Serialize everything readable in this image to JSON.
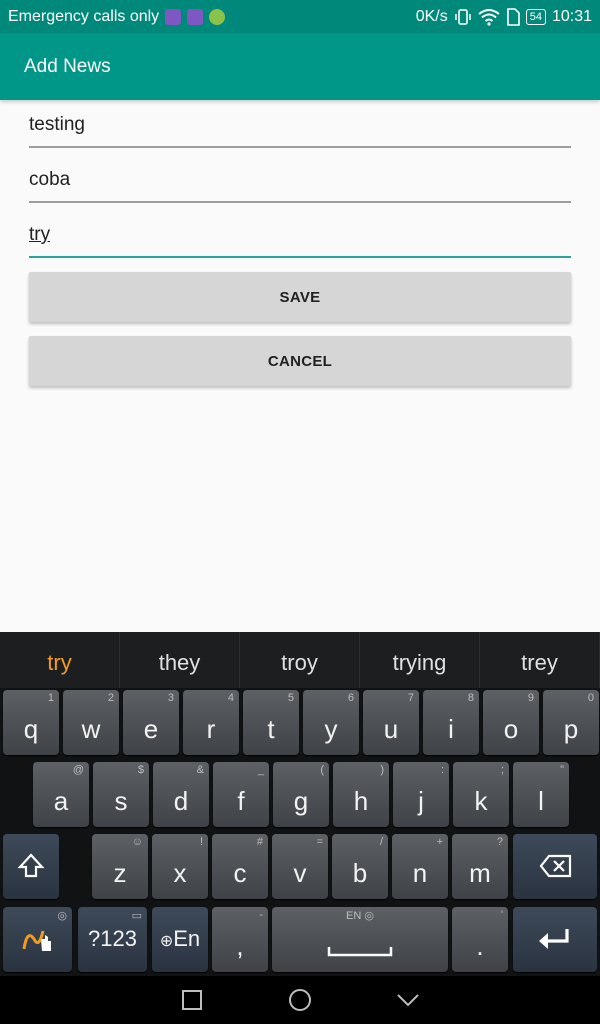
{
  "status_bar": {
    "carrier_text": "Emergency calls only",
    "net_speed": "0K/s",
    "battery": "54",
    "time": "10:31"
  },
  "app_bar": {
    "title": "Add News"
  },
  "form": {
    "field1_value": "testing",
    "field2_value": "coba",
    "field3_value": "try",
    "save_label": "SAVE",
    "cancel_label": "CANCEL"
  },
  "keyboard": {
    "suggestions": [
      "try",
      "they",
      "troy",
      "trying",
      "trey"
    ],
    "row1": [
      {
        "k": "q",
        "h": "1"
      },
      {
        "k": "w",
        "h": "2"
      },
      {
        "k": "e",
        "h": "3"
      },
      {
        "k": "r",
        "h": "4"
      },
      {
        "k": "t",
        "h": "5"
      },
      {
        "k": "y",
        "h": "6"
      },
      {
        "k": "u",
        "h": "7"
      },
      {
        "k": "i",
        "h": "8"
      },
      {
        "k": "o",
        "h": "9"
      },
      {
        "k": "p",
        "h": "0"
      }
    ],
    "row2": [
      {
        "k": "a",
        "h": "@"
      },
      {
        "k": "s",
        "h": "$"
      },
      {
        "k": "d",
        "h": "&"
      },
      {
        "k": "f",
        "h": "_"
      },
      {
        "k": "g",
        "h": "("
      },
      {
        "k": "h",
        "h": ")"
      },
      {
        "k": "j",
        "h": ":"
      },
      {
        "k": "k",
        "h": ";"
      },
      {
        "k": "l",
        "h": "\""
      }
    ],
    "row3": [
      {
        "k": "z",
        "h": "☺"
      },
      {
        "k": "x",
        "h": "!"
      },
      {
        "k": "c",
        "h": "#"
      },
      {
        "k": "v",
        "h": "="
      },
      {
        "k": "b",
        "h": "/"
      },
      {
        "k": "n",
        "h": "+"
      },
      {
        "k": "m",
        "h": "?"
      }
    ],
    "symbols_label": "?123",
    "lang_label": "En",
    "comma": ",",
    "comma_hint": "-",
    "period": ".",
    "period_hint": "'",
    "space_hint": "EN"
  },
  "icons": {
    "shift": "shift-icon",
    "backspace": "backspace-icon",
    "enter": "enter-icon",
    "swype": "swype-icon",
    "nav_recent": "recent-apps-icon",
    "nav_home": "home-icon",
    "nav_back": "back-icon"
  },
  "colors": {
    "primary": "#009688",
    "primary_dark": "#00897b",
    "accent_underline": "#26a69a",
    "suggestion_primary": "#f59b1e"
  }
}
